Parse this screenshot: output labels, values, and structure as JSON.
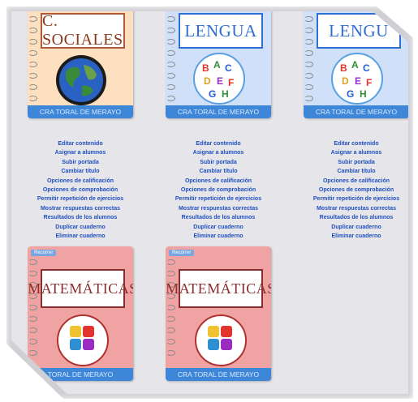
{
  "notebooks": [
    {
      "title": "C. SOCIALES",
      "footer": "CRA TORAL DE MERAYO",
      "icon": "earth-globe-icon",
      "accent": "#b05a3c"
    },
    {
      "title": "LENGUA",
      "footer": "CRA TORAL DE MERAYO",
      "icon": "alphabet-circle-icon",
      "accent": "#2f6fd1"
    },
    {
      "title": "LENGU",
      "footer": "CRA TORAL DE MERAYO",
      "icon": "alphabet-circle-icon",
      "accent": "#2f6fd1"
    },
    {
      "title": "MATEMÁTICAS",
      "footer": "TORAL DE MERAYO",
      "tag": "Recorrer",
      "icon": "math-puzzle-icon",
      "accent": "#8a2d2d"
    },
    {
      "title": "MATEMÁTICAS",
      "footer": "CRA TORAL DE MERAYO",
      "tag": "Recorrer",
      "icon": "math-puzzle-icon",
      "accent": "#8a2d2d"
    }
  ],
  "menu_items": [
    "Editar contenido",
    "Asignar a alumnos",
    "Subir portada",
    "Cambiar título",
    "Opciones de calificación",
    "Opciones de comprobación",
    "Permitir repetición de ejercicios",
    "Mostrar respuestas correctas",
    "Resultados de los alumnos",
    "Duplicar cuaderno",
    "Eliminar cuaderno"
  ],
  "colors": {
    "link": "#1f4fbf",
    "footer_bar": "#3d86d8",
    "panel_bg": "#e6e6ea"
  }
}
